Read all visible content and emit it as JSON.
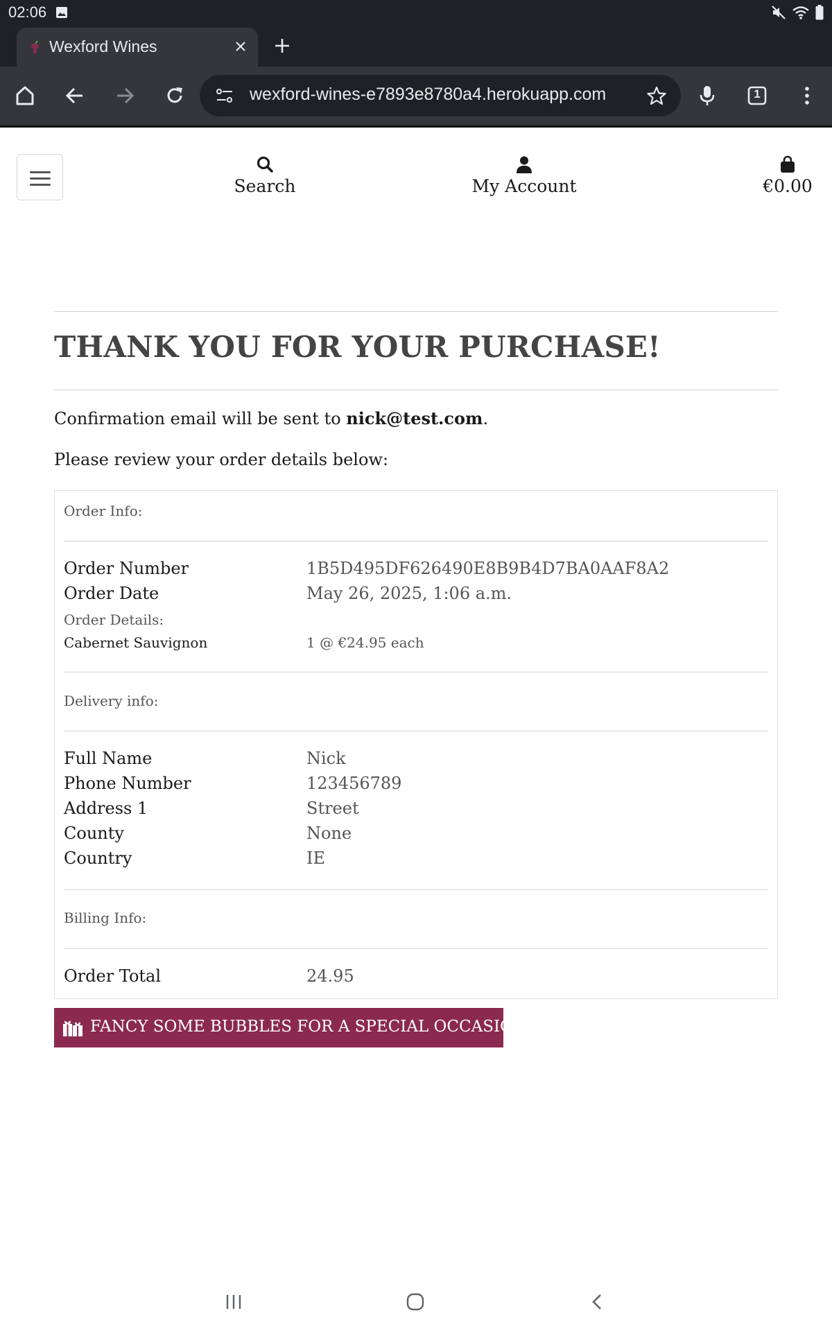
{
  "status_bar": {
    "time": "02:06"
  },
  "browser": {
    "tab_title": "Wexford Wines",
    "url": "wexford-wines-e7893e8780a4.herokuapp.com",
    "tab_count": "1"
  },
  "site_nav": {
    "search_label": "Search",
    "account_label": "My Account",
    "bag_total": "€0.00"
  },
  "checkout": {
    "title": "THANK YOU FOR YOUR PURCHASE!",
    "confirm_prefix": "Confirmation email will be sent to ",
    "email": "nick@test.com",
    "confirm_suffix": ".",
    "review_text": "Please review your order details below:"
  },
  "order_info": {
    "section_label": "Order Info:",
    "order_number_label": "Order Number",
    "order_number": "1B5D495DF626490E8B9B4D7BA0AAF8A2",
    "order_date_label": "Order Date",
    "order_date": "May 26, 2025, 1:06 a.m.",
    "details_label": "Order Details:",
    "items": [
      {
        "name": "Cabernet Sauvignon",
        "quantity_price": "1 @ €24.95 each"
      }
    ]
  },
  "delivery_info": {
    "section_label": "Delivery info:",
    "rows": [
      {
        "label": "Full Name",
        "value": "Nick"
      },
      {
        "label": "Phone Number",
        "value": "123456789"
      },
      {
        "label": "Address 1",
        "value": "Street"
      },
      {
        "label": "County",
        "value": "None"
      },
      {
        "label": "Country",
        "value": "IE"
      }
    ]
  },
  "billing_info": {
    "section_label": "Billing Info:",
    "order_total_label": "Order Total",
    "order_total": "24.95"
  },
  "promo": {
    "label": "FANCY SOME BUBBLES FOR A SPECIAL OCCASION?",
    "color": "#8b2a4e"
  }
}
